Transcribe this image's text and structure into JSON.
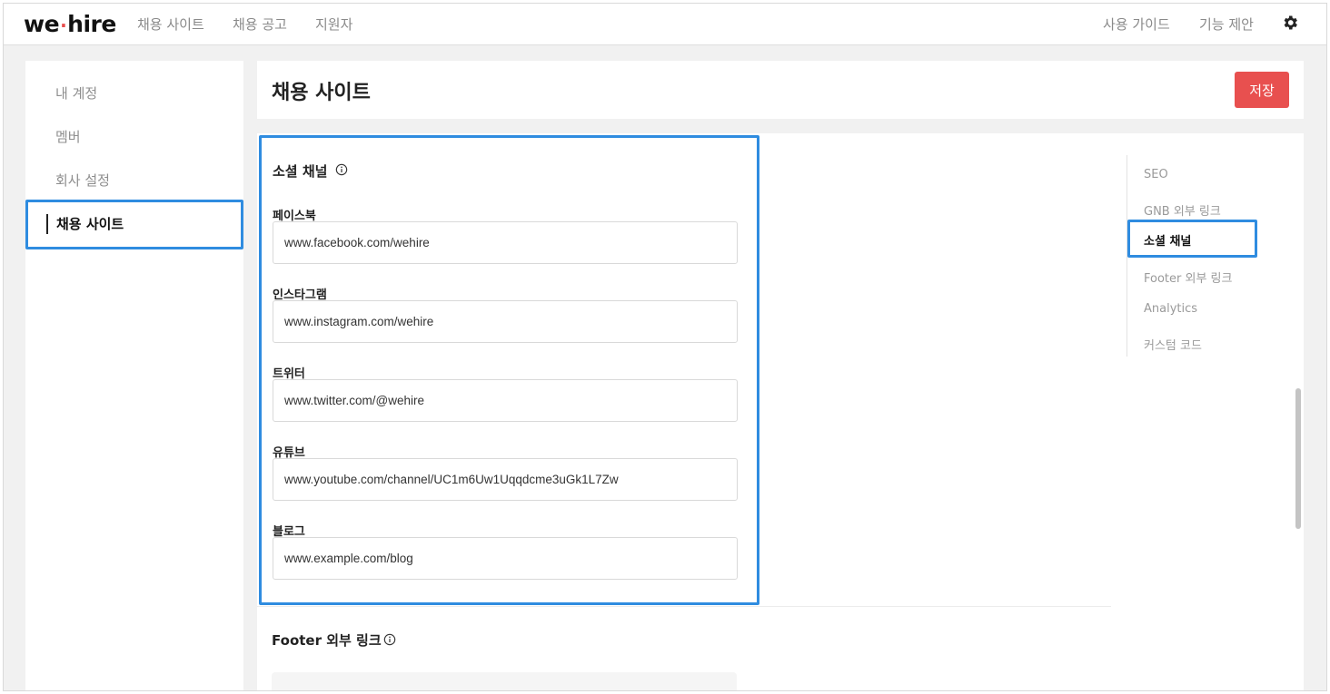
{
  "brand": {
    "logo_left": "we",
    "logo_dot": "·",
    "logo_right": "hire"
  },
  "topnav": {
    "left_links": [
      "채용 사이트",
      "채용 공고",
      "지원자"
    ],
    "right_links": [
      "사용 가이드",
      "기능 제안"
    ],
    "settings_icon": "gear-icon"
  },
  "sidebar": {
    "items": [
      "내 계정",
      "멤버",
      "회사 설정",
      "채용 사이트"
    ],
    "active": "채용 사이트"
  },
  "header": {
    "title": "채용 사이트",
    "save_label": "저장"
  },
  "social": {
    "title": "소셜 채널",
    "info_icon": "info-icon",
    "fields": [
      {
        "label": "페이스북",
        "value": "www.facebook.com/wehire"
      },
      {
        "label": "인스타그램",
        "value": "www.instagram.com/wehire"
      },
      {
        "label": "트위터",
        "value": "www.twitter.com/@wehire"
      },
      {
        "label": "유튜브",
        "value": "www.youtube.com/channel/UC1m6Uw1Uqqdcme3uGk1L7Zw"
      },
      {
        "label": "블로그",
        "value": "www.example.com/blog"
      }
    ]
  },
  "footer_links": {
    "title": "Footer 외부 링크"
  },
  "toc": {
    "items": [
      "SEO",
      "GNB 외부 링크",
      "소셜 채널",
      "Footer 외부 링크",
      "Analytics",
      "커스텀 코드"
    ],
    "active": "소셜 채널"
  },
  "colors": {
    "accent": "#e8504f",
    "highlight": "#2f8ce0"
  }
}
